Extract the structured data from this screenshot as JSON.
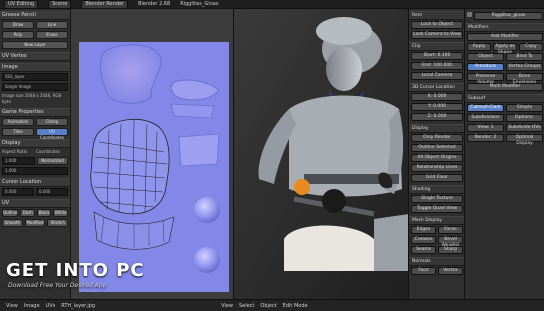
{
  "topbar": {
    "items": [
      "UV Editing",
      "Scene",
      "Blender Render",
      "Blender 2.68",
      "Rigglitas_Ginas"
    ],
    "colors": {
      "accent": "#5a7fc2"
    }
  },
  "left_panel": {
    "section1": "Grease Pencil",
    "draw_label": "Draw",
    "line_label": "Line",
    "poly_label": "Poly",
    "erase_label": "Erase",
    "new_layer": "New Layer",
    "section2": "UV Vertex",
    "section3": "Image",
    "image_field": "SSS_layer",
    "source_field": "Single Image",
    "image_info": "Image size 2048 x 2048, RGB byte",
    "section4": "Game Properties",
    "animation": "Animation",
    "clamp": "Clamp",
    "tiles": "Tiles",
    "uv_coord": "UV Coordinates",
    "section5": "Display",
    "aspect": "Aspect Ratio",
    "coord": "Coordinates",
    "x_val": "1.000",
    "y_val": "1.000",
    "normalized": "Normalized",
    "section6": "Cursor Location",
    "cx": "0.000",
    "cy": "0.000",
    "section7": "UV",
    "outline": "Outline",
    "dash": "Dash",
    "black": "Black",
    "white": "White",
    "smooth": "Smooth",
    "modified": "Modified",
    "stretch": "Stretch"
  },
  "right_panel": {
    "header": "Item",
    "add_mode": "Add Modifier",
    "layers": [
      "Lock to Object",
      "Lock Camera to View"
    ],
    "clip": "Clip",
    "start": "Start: 0.100",
    "end": "End: 100.000",
    "local_camera": "Local Camera",
    "cursor_location": "3D Cursor Location",
    "x": "X: 0.000",
    "y": "Y: 0.000",
    "z": "Z: 0.000",
    "display": "Display",
    "only_render": "Only Render",
    "outline_selected": "Outline Selected",
    "all_object_origins": "All Object Origins",
    "relationship_lines": "Relationship Lines",
    "grid_floor": "Grid Floor",
    "shading": "Shading",
    "single_texture": "Single Texture",
    "toggle_quad_view": "Toggle Quad View",
    "mesh_display": "Mesh Display",
    "edges": "Edges",
    "faces": "Faces",
    "creases": "Creases",
    "bevel_weights": "Bevel Weights",
    "seams": "Seams",
    "sharp": "Sharp",
    "normals": "Normals",
    "face": "Face",
    "vertex": "Vertex"
  },
  "props_panel": {
    "name": "Rigglitas_ginas",
    "modifiers": "Modifiers",
    "add_modifier": "Add Modifier",
    "apply": "Apply",
    "apply_as_shape": "Apply as Shape",
    "copy": "Copy",
    "object": "Object",
    "bind_to": "Bind To",
    "armature": "Armature",
    "vertex_groups": "Vertex Groups",
    "preserve_volume": "Preserve Volume",
    "bone_envelopes": "Bone Envelopes",
    "multi_modifier": "Multi Modifier",
    "subsurf": "Subsurf",
    "simple": "Simple",
    "catmull_clark": "Catmull-Clark",
    "subdivisions": "Subdivisions",
    "view": "View: 1",
    "render": "Render: 2",
    "options": "Options:",
    "subdivide_uvs": "Subdivide UVs",
    "optimal_display": "Optimal Display"
  },
  "status": {
    "left_items": [
      "View",
      "Image",
      "UVs",
      "RTH_layer.jpg"
    ],
    "right_items": [
      "View",
      "Select",
      "Object",
      "Edit Mode"
    ],
    "watermark_main": "GET INTO PC",
    "watermark_sub": "Download Free Your Desired App"
  }
}
